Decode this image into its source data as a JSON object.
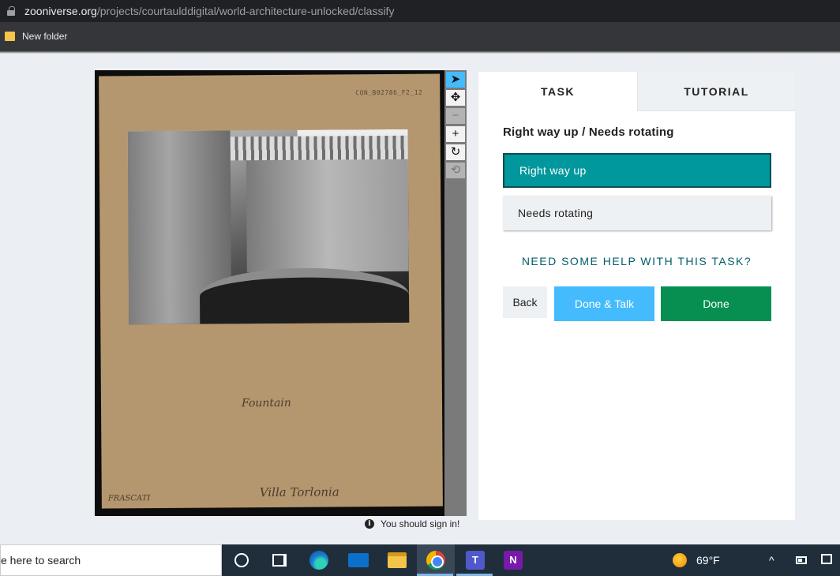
{
  "browser": {
    "url_domain": "zooniverse.org",
    "url_path": "/projects/courtaulddigital/world-architecture-unlocked/classify",
    "bookmark": "New folder"
  },
  "subject": {
    "card_id": "CON_B02786_F2_12",
    "caption_main": "Fountain",
    "caption_place": "Villa Torlonia",
    "caption_town": "FRASCATI"
  },
  "toolbar": {
    "tools": [
      {
        "name": "annotate-pointer",
        "glyph": "➤"
      },
      {
        "name": "move",
        "glyph": "✥"
      },
      {
        "name": "zoom-out",
        "glyph": "−"
      },
      {
        "name": "zoom-in",
        "glyph": "+"
      },
      {
        "name": "rotate",
        "glyph": "↻"
      },
      {
        "name": "reset",
        "glyph": "⟲"
      }
    ]
  },
  "sign_in_notice": "You should sign in!",
  "panel": {
    "tabs": [
      "TASK",
      "TUTORIAL"
    ],
    "question": "Right way up / Needs rotating",
    "answers": [
      "Right way up",
      "Needs rotating"
    ],
    "help_link": "NEED SOME HELP WITH THIS TASK?",
    "buttons": {
      "back": "Back",
      "done_talk": "Done & Talk",
      "done": "Done"
    }
  },
  "taskbar": {
    "search_text": "e here to search",
    "teams_label": "T",
    "onenote_label": "N",
    "weather": "69°F",
    "tray_chevron": "^"
  },
  "colors": {
    "answer_selected": "#00979d",
    "done_button": "#078f52",
    "done_talk_button": "#43bbfd",
    "help_link": "#005d69"
  }
}
